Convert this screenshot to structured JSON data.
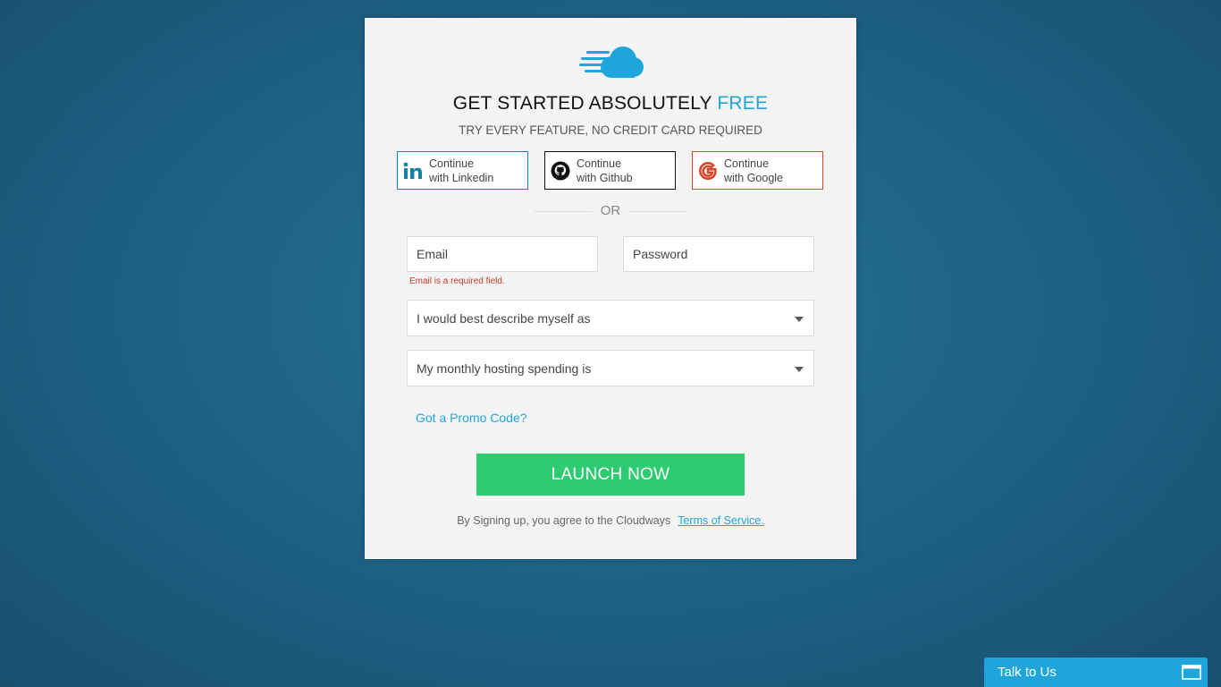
{
  "header": {
    "title_prefix": "GET STARTED ABSOLUTELY ",
    "title_accent": "FREE",
    "subtitle": "TRY EVERY FEATURE, NO CREDIT CARD REQUIRED"
  },
  "social": {
    "linkedin": {
      "line1": "Continue",
      "line2": "with Linkedin",
      "icon": "linkedin-icon"
    },
    "github": {
      "line1": "Continue",
      "line2": "with Github",
      "icon": "github-icon"
    },
    "google": {
      "line1": "Continue",
      "line2": "with Google",
      "icon": "google-icon"
    }
  },
  "divider": {
    "text": "OR"
  },
  "form": {
    "email_placeholder": "Email",
    "email_value": "",
    "password_placeholder": "Password",
    "password_value": "",
    "email_error": "Email is a required field.",
    "role_select": "I would best describe myself as",
    "spending_select": "My monthly hosting spending is",
    "promo_link": "Got a Promo Code?",
    "launch_button": "LAUNCH NOW"
  },
  "terms": {
    "text": "By Signing up, you agree to the Cloudways",
    "link": "Terms of Service."
  },
  "chat": {
    "label": "Talk to Us",
    "icon": "window-icon"
  },
  "colors": {
    "accent": "#1ea6dc",
    "launch": "#2ecc71",
    "linkedin": "#1582a7",
    "google": "#d9472b",
    "error": "#c0392b"
  }
}
